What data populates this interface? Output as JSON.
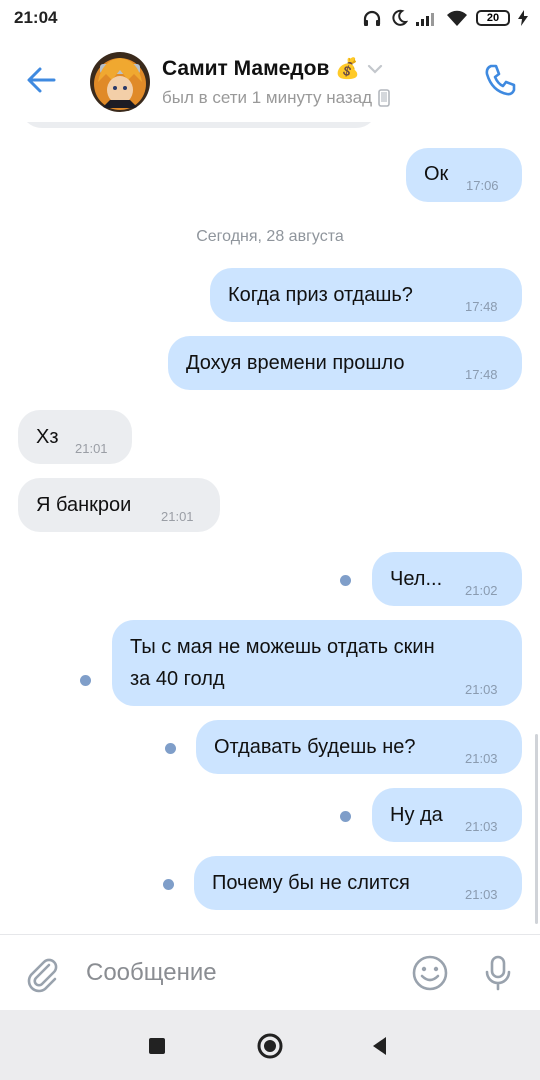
{
  "status_bar": {
    "time": "21:04",
    "battery": "20",
    "icons": [
      "headphones-icon",
      "moon-icon",
      "signal-icon",
      "wifi-icon",
      "battery-icon",
      "charging-icon"
    ]
  },
  "header": {
    "name": "Самит Мамедов",
    "name_emoji": "💰",
    "status": "был в сети 1 минуту назад",
    "accent_color": "#3f8ae0"
  },
  "chat": {
    "date_divider": "Сегодня, 28 августа",
    "messages": [
      {
        "dir": "out",
        "text": "Ок",
        "time": "17:06",
        "unread": false
      },
      {
        "dir": "out",
        "text": "Когда приз отдашь?",
        "time": "17:48",
        "unread": false
      },
      {
        "dir": "out",
        "text": "Дохуя времени прошло",
        "time": "17:48",
        "unread": false
      },
      {
        "dir": "in",
        "text": "Хз",
        "time": "21:01"
      },
      {
        "dir": "in",
        "text": "Я банкрои",
        "time": "21:01"
      },
      {
        "dir": "out",
        "text": "Чел...",
        "time": "21:02",
        "unread": true
      },
      {
        "dir": "out",
        "text": "Ты с мая не можешь отдать скин",
        "text2": "за 40 голд",
        "time": "21:03",
        "unread": true
      },
      {
        "dir": "out",
        "text": "Отдавать будешь не?",
        "time": "21:03",
        "unread": true
      },
      {
        "dir": "out",
        "text": "Ну да",
        "time": "21:03",
        "unread": true
      },
      {
        "dir": "out",
        "text": "Почему бы не слится",
        "time": "21:03",
        "unread": true
      }
    ],
    "colors": {
      "outgoing": "#cce4ff",
      "incoming": "#ebedf0",
      "unread_dot": "#7f9ec9"
    }
  },
  "composer": {
    "placeholder": "Сообщение"
  },
  "nav": {
    "icons": [
      "square-recent-icon",
      "circle-home-icon",
      "triangle-back-icon"
    ]
  }
}
